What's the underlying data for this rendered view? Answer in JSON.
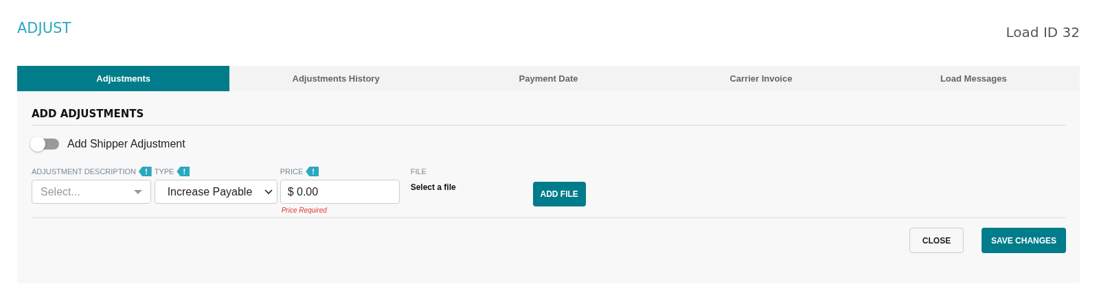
{
  "title": "ADJUST",
  "load_id": "Load ID 32",
  "tabs": [
    {
      "label": "Adjustments",
      "selected": true
    },
    {
      "label": "Adjustments History",
      "selected": false
    },
    {
      "label": "Payment Date",
      "selected": false
    },
    {
      "label": "Carrier Invoice",
      "selected": false
    },
    {
      "label": "Load Messages",
      "selected": false
    }
  ],
  "section": "ADD ADJUSTMENTS",
  "toggle": {
    "label": "Add Shipper Adjustment",
    "on": false
  },
  "fields": [
    {
      "kind": "combo",
      "label": "ADJUSTMENT DESCRIPTION",
      "flag": "!",
      "placeholder": "Select..."
    },
    {
      "kind": "select",
      "label": "TYPE",
      "flag": "!",
      "value": "Increase Payable"
    },
    {
      "kind": "input",
      "label": "PRICE",
      "flag": "!",
      "value": "$ 0.00",
      "error": "Price Required"
    },
    {
      "kind": "file",
      "label": "FILE",
      "value": "Select a file",
      "button": "ADD FILE"
    }
  ],
  "buttons": [
    {
      "kind": "secondary",
      "label": "CLOSE"
    },
    {
      "kind": "primary",
      "label": "SAVE CHANGES"
    }
  ]
}
